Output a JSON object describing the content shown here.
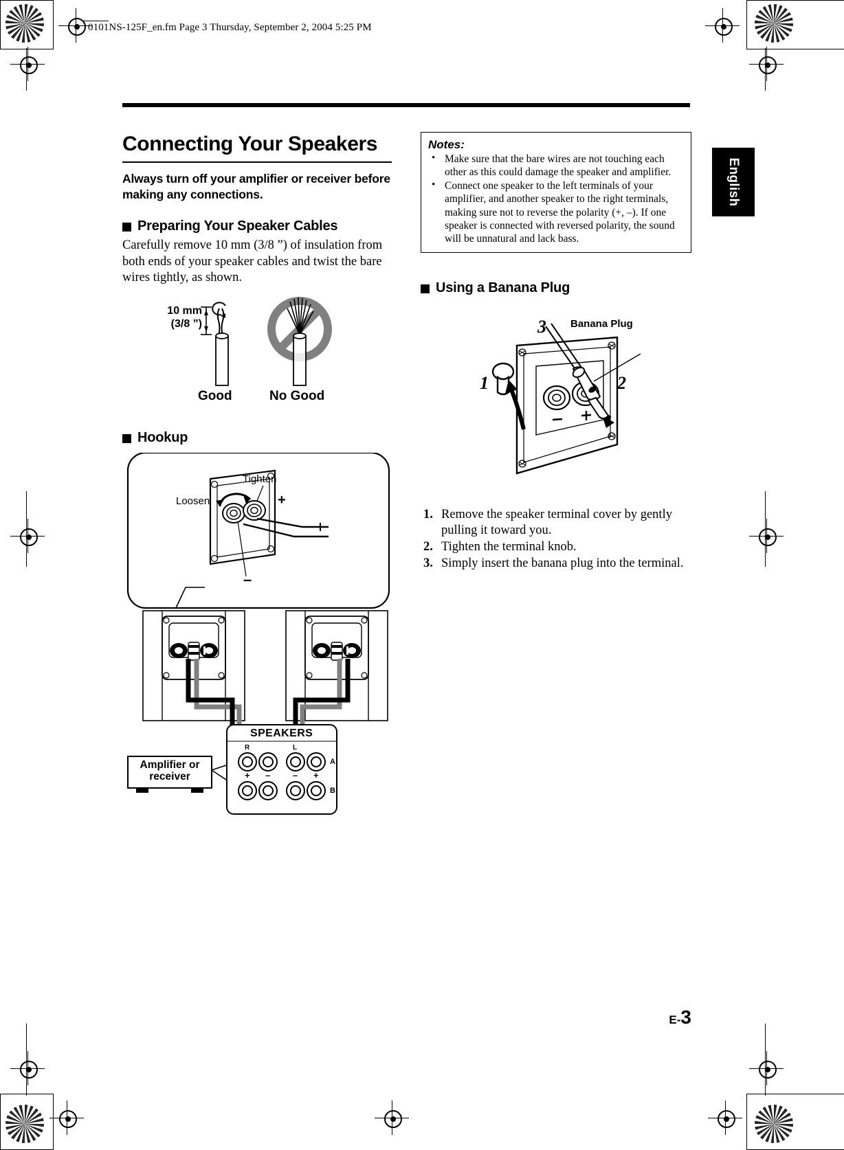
{
  "header": {
    "file_info": "0101NS-125F_en.fm  Page 3  Thursday, September 2, 2004  5:25 PM"
  },
  "side_tab": {
    "label": "English"
  },
  "main": {
    "title": "Connecting Your Speakers",
    "lead": "Always turn off your amplifier or receiver before making any connections.",
    "sections": [
      {
        "heading": "Preparing Your Speaker Cables",
        "body": "Carefully remove 10 mm (3/8 ”) of insulation from both ends of your speaker cables and twist the bare wires tightly, as shown."
      },
      {
        "heading": "Hookup"
      },
      {
        "heading": "Using a Banana Plug"
      }
    ]
  },
  "cable_figure": {
    "measurement_line1": "10 mm",
    "measurement_line2": "(3/8 ”)",
    "good_label": "Good",
    "no_good_label": "No Good"
  },
  "notes": {
    "title": "Notes:",
    "items": [
      "Make sure that the bare wires are not touching each other as this could damage the speaker and amplifier.",
      "Connect one speaker to the left terminals of your amplifier, and another speaker to the right terminals, making sure not to reverse the polarity (+, –). If one speaker is connected with reversed polarity, the sound will be unnatural and lack bass."
    ]
  },
  "hookup_figure": {
    "tighten_label": "Tighten",
    "loosen_label": "Loosen",
    "plus_label": "+",
    "minus_label": "–",
    "amplifier_label_line1": "Amplifier or",
    "amplifier_label_line2": "receiver",
    "speakers_label": "SPEAKERS",
    "terminal_r": "R",
    "terminal_l": "L",
    "row_a": "A",
    "row_b": "B",
    "polarity_marks": [
      "+",
      "–",
      "–",
      "+"
    ]
  },
  "banana_figure": {
    "callout_1": "1",
    "callout_2": "2",
    "callout_3": "3",
    "plug_label": "Banana Plug",
    "minus_label": "–",
    "plus_label": "+"
  },
  "banana_steps": [
    "Remove the speaker terminal cover by gently pulling it toward you.",
    "Tighten the terminal knob.",
    "Simply insert the banana plug into the terminal."
  ],
  "footer": {
    "page_prefix": "E-",
    "page_number": "3"
  }
}
